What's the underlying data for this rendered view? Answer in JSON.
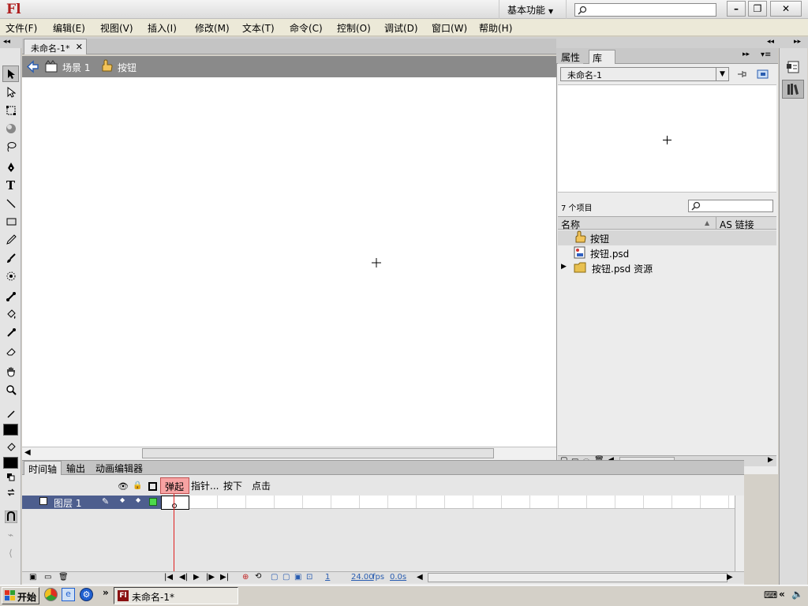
{
  "app": {
    "logo": "Fl",
    "workspace": "基本功能"
  },
  "menu": [
    "文件(F)",
    "编辑(E)",
    "视图(V)",
    "插入(I)",
    "修改(M)",
    "文本(T)",
    "命令(C)",
    "控制(O)",
    "调试(D)",
    "窗口(W)",
    "帮助(H)"
  ],
  "document": {
    "tab": "未命名-1*",
    "scene": "场景 1",
    "symbol": "按钮"
  },
  "panel": {
    "tabs": [
      "属性",
      "库"
    ],
    "library_select": "未命名-1",
    "item_count": "7 个项目",
    "col_name": "名称",
    "col_link": "AS 链接",
    "items": [
      {
        "name": "按钮",
        "icon": "button-symbol-icon"
      },
      {
        "name": "按钮.psd",
        "icon": "psd-bitmap-icon"
      },
      {
        "name": "按钮.psd 资源",
        "icon": "folder-icon"
      }
    ]
  },
  "timeline": {
    "tabs": [
      "时间轴",
      "输出",
      "动画编辑器"
    ],
    "frame_labels": [
      "弹起",
      "指针...",
      "按下",
      "点击"
    ],
    "layer": "图层 1",
    "current_frame": "1",
    "fps": "24.00",
    "fps_unit": "fps",
    "elapsed": "0.0s"
  },
  "taskbar": {
    "start": "开始",
    "item": "未命名-1*"
  }
}
